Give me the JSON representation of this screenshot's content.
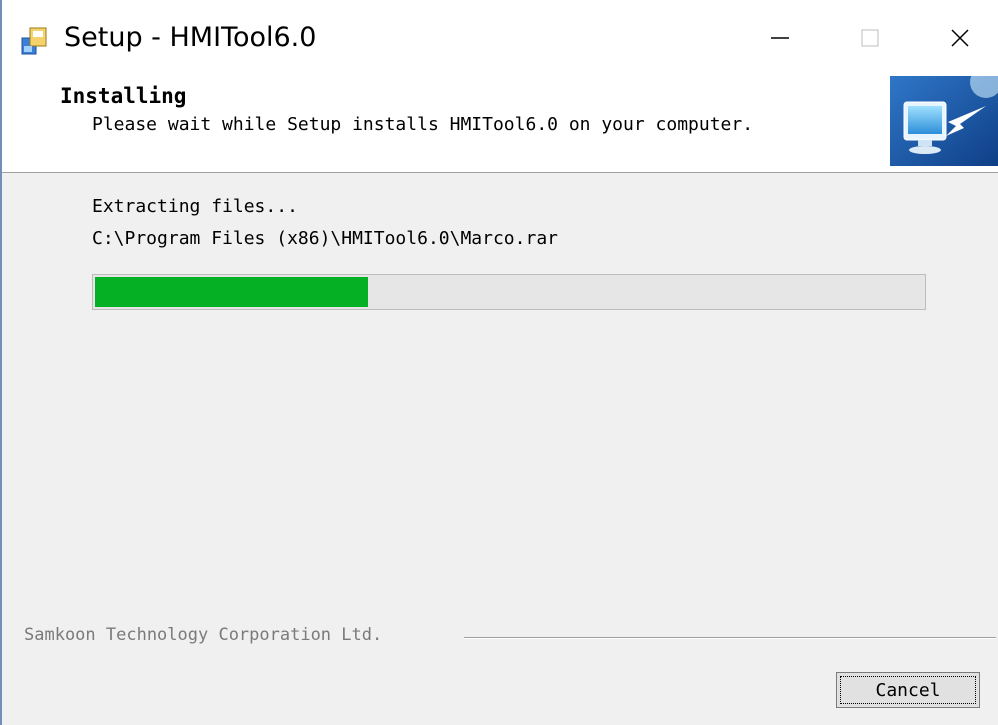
{
  "window": {
    "title": "Setup - HMITool6.0",
    "icons": {
      "app": "setup-icon",
      "minimize": "minimize-icon",
      "maximize": "maximize-icon",
      "close": "close-icon"
    }
  },
  "header": {
    "title": "Installing",
    "subtitle": "Please wait while Setup installs HMITool6.0 on your computer.",
    "art": "installer-computer-icon"
  },
  "status": {
    "action": "Extracting files...",
    "file": "C:\\Program Files (x86)\\HMITool6.0\\Marco.rar"
  },
  "progress": {
    "fraction": 0.33,
    "color": "#06b025"
  },
  "footer": {
    "branding": "Samkoon Technology Corporation Ltd.",
    "cancel_label": "Cancel"
  }
}
